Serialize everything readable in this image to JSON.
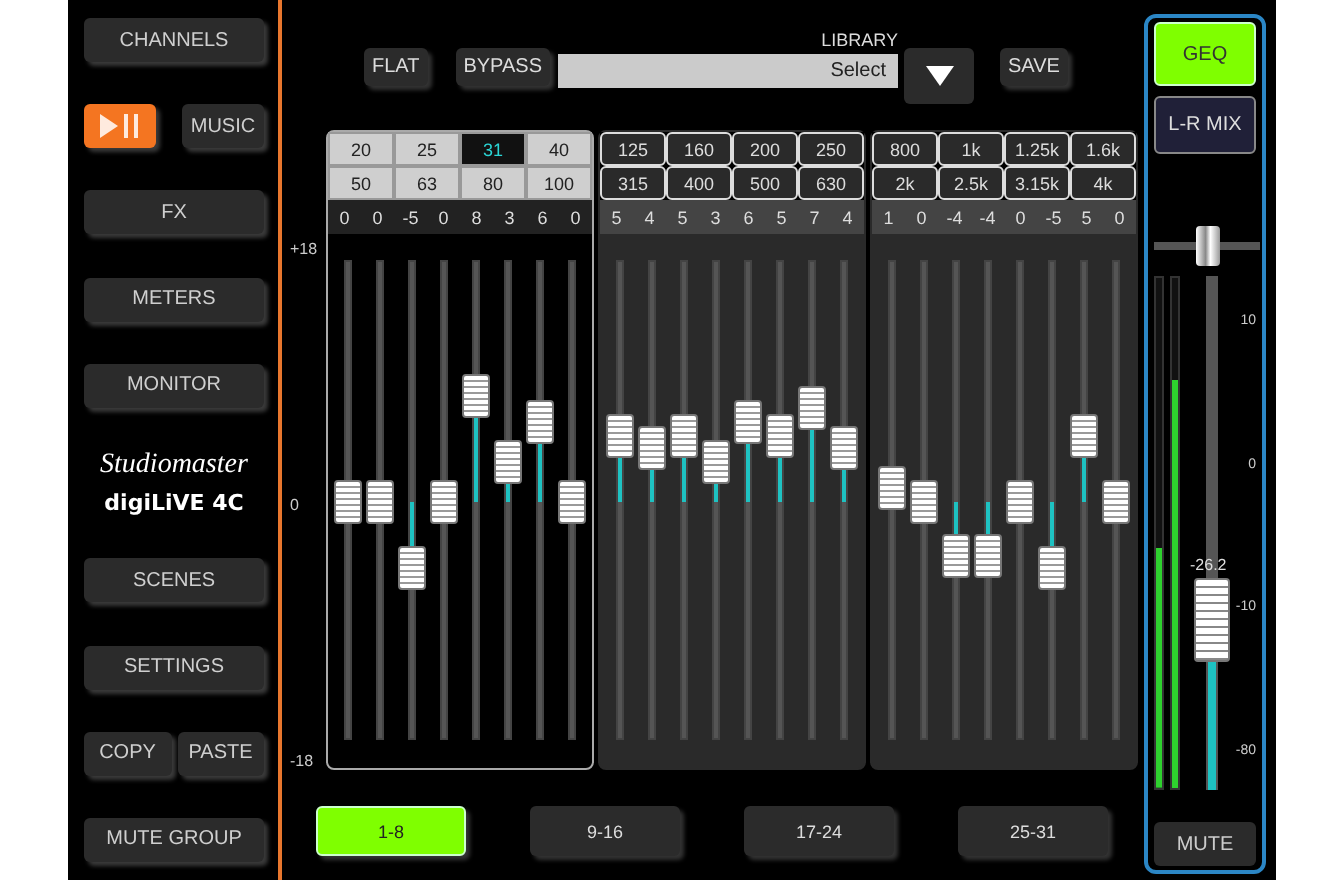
{
  "sidebar": {
    "rows": [
      {
        "kind": "buttons",
        "buttons": [
          {
            "kind": "text",
            "label": "CHANNELS"
          }
        ]
      },
      {
        "kind": "buttons",
        "buttons": [
          {
            "kind": "play",
            "active": true
          },
          {
            "kind": "text",
            "label": "MUSIC"
          }
        ]
      },
      {
        "kind": "buttons",
        "buttons": [
          {
            "kind": "text",
            "label": "FX"
          }
        ]
      },
      {
        "kind": "buttons",
        "buttons": [
          {
            "kind": "text",
            "label": "METERS"
          }
        ]
      },
      {
        "kind": "buttons",
        "buttons": [
          {
            "kind": "text",
            "label": "MONITOR"
          }
        ]
      },
      {
        "kind": "logo",
        "brand": "Studiomaster",
        "product": "digiLiVE 4C"
      },
      {
        "kind": "buttons",
        "buttons": [
          {
            "kind": "text",
            "label": "SCENES"
          }
        ]
      },
      {
        "kind": "buttons",
        "buttons": [
          {
            "kind": "text",
            "label": "SETTINGS"
          }
        ]
      },
      {
        "kind": "buttons",
        "buttons": [
          {
            "kind": "text",
            "label": "COPY"
          },
          {
            "kind": "text",
            "label": "PASTE"
          }
        ]
      },
      {
        "kind": "buttons",
        "buttons": [
          {
            "kind": "text",
            "label": "MUTE GROUP"
          }
        ]
      }
    ]
  },
  "toolbar": {
    "buttons": [
      "FLAT",
      "BYPASS"
    ],
    "library": {
      "label": "LIBRARY",
      "value": "Select"
    },
    "save": "SAVE"
  },
  "scale": [
    "+18",
    "0",
    "-18"
  ],
  "groups": [
    {
      "selected": true,
      "frequencies": [
        {
          "label": "20",
          "selected": false
        },
        {
          "label": "25",
          "selected": false
        },
        {
          "label": "31",
          "selected": true
        },
        {
          "label": "40",
          "selected": false
        },
        {
          "label": "50",
          "selected": false
        },
        {
          "label": "63",
          "selected": false
        },
        {
          "label": "80",
          "selected": false
        },
        {
          "label": "100",
          "selected": false
        }
      ],
      "bands": [
        {
          "value": "0",
          "level": 0.5
        },
        {
          "value": "0",
          "level": 0.5
        },
        {
          "value": "-5",
          "level": 0.361
        },
        {
          "value": "0",
          "level": 0.5
        },
        {
          "value": "8",
          "level": 0.722
        },
        {
          "value": "3",
          "level": 0.583
        },
        {
          "value": "6",
          "level": 0.667
        },
        {
          "value": "0",
          "level": 0.5
        }
      ]
    },
    {
      "selected": false,
      "frequencies": [
        {
          "label": "125",
          "selected": false
        },
        {
          "label": "160",
          "selected": false
        },
        {
          "label": "200",
          "selected": false
        },
        {
          "label": "250",
          "selected": false
        },
        {
          "label": "315",
          "selected": false
        },
        {
          "label": "400",
          "selected": false
        },
        {
          "label": "500",
          "selected": false
        },
        {
          "label": "630",
          "selected": false
        }
      ],
      "bands": [
        {
          "value": "5",
          "level": 0.639
        },
        {
          "value": "4",
          "level": 0.611
        },
        {
          "value": "5",
          "level": 0.639
        },
        {
          "value": "3",
          "level": 0.583
        },
        {
          "value": "6",
          "level": 0.667
        },
        {
          "value": "5",
          "level": 0.639
        },
        {
          "value": "7",
          "level": 0.694
        },
        {
          "value": "4",
          "level": 0.611
        }
      ]
    },
    {
      "selected": false,
      "frequencies": [
        {
          "label": "800",
          "selected": false
        },
        {
          "label": "1k",
          "selected": false
        },
        {
          "label": "1.25k",
          "selected": false
        },
        {
          "label": "1.6k",
          "selected": false
        },
        {
          "label": "2k",
          "selected": false
        },
        {
          "label": "2.5k",
          "selected": false
        },
        {
          "label": "3.15k",
          "selected": false
        },
        {
          "label": "4k",
          "selected": false
        }
      ],
      "bands": [
        {
          "value": "1",
          "level": 0.528
        },
        {
          "value": "0",
          "level": 0.5
        },
        {
          "value": "-4",
          "level": 0.389
        },
        {
          "value": "-4",
          "level": 0.389
        },
        {
          "value": "0",
          "level": 0.5
        },
        {
          "value": "-5",
          "level": 0.361
        },
        {
          "value": "5",
          "level": 0.639
        },
        {
          "value": "0",
          "level": 0.5
        }
      ]
    }
  ],
  "banks": [
    {
      "label": "1-8",
      "selected": true
    },
    {
      "label": "9-16",
      "selected": false
    },
    {
      "label": "17-24",
      "selected": false
    },
    {
      "label": "25-31",
      "selected": false
    }
  ],
  "master": {
    "tabs": [
      {
        "label": "GEQ",
        "selected": true
      },
      {
        "label": "L-R MIX",
        "selected": false
      }
    ],
    "pan": {
      "level": 0.5
    },
    "meters": [
      {
        "level": 0.47
      },
      {
        "level": 0.8
      }
    ],
    "fader": {
      "level": 0.33,
      "reading": "-26.2"
    },
    "scale": [
      "10",
      "0",
      "-10",
      "-80"
    ],
    "mute": "MUTE"
  }
}
